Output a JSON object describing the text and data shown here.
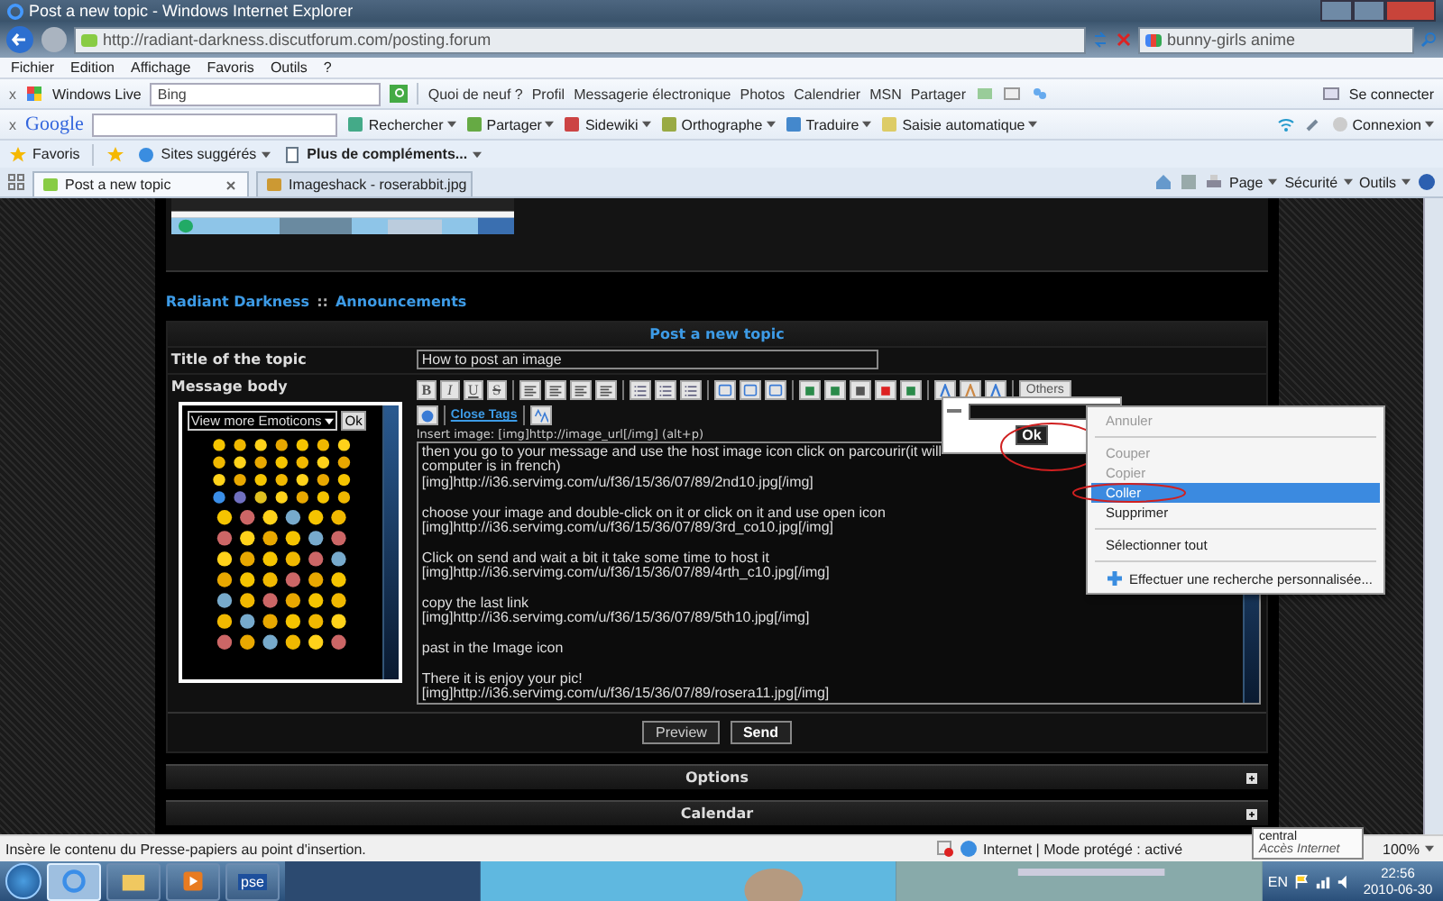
{
  "window": {
    "title": "Post a new topic - Windows Internet Explorer"
  },
  "address_bar": {
    "url": "http://radiant-darkness.discutforum.com/posting.forum",
    "search_value": "bunny-girls anime"
  },
  "menu_bar": [
    "Fichier",
    "Edition",
    "Affichage",
    "Favoris",
    "Outils",
    "?"
  ],
  "live_toolbar": {
    "close": "x",
    "brand": "Windows Live",
    "search_value": "Bing",
    "links": [
      "Quoi de neuf ?",
      "Profil",
      "Messagerie électronique",
      "Photos",
      "Calendrier",
      "MSN",
      "Partager"
    ],
    "sign_in": "Se connecter"
  },
  "google_toolbar": {
    "close": "x",
    "brand": "Google",
    "buttons": [
      "Rechercher",
      "Partager",
      "Sidewiki",
      "Orthographe",
      "Traduire",
      "Saisie automatique"
    ],
    "sign_in": "Connexion"
  },
  "favorites_bar": {
    "favorites": "Favoris",
    "items": [
      {
        "label": "Sites suggérés",
        "kind": "link"
      },
      {
        "label": "Plus de compléments...",
        "kind": "addon"
      }
    ]
  },
  "tabs": [
    {
      "label": "Post a new topic",
      "selected": true
    },
    {
      "label": "Imageshack - roserabbit.jpg",
      "selected": false
    }
  ],
  "command_bar": [
    "Page",
    "Sécurité",
    "Outils"
  ],
  "forum": {
    "breadcrumb": [
      "Radiant Darkness",
      "Announcements"
    ],
    "breadcrumb_separator": "::",
    "form_title": "Post a new topic",
    "title_label": "Title of the topic",
    "title_value": "How to post an image",
    "body_label": "Message body",
    "emoticon_select": "View more Emoticons",
    "emoticon_ok": "Ok",
    "format_buttons": [
      "B",
      "I",
      "U",
      "S"
    ],
    "others": "Others",
    "close_tags": "Close Tags",
    "hint": "Insert image: [img]http://image_url[/img] (alt+p)",
    "message": [
      [
        "then you go to your message and use the host image icon click on parcourir(it will",
        "computer is in french)",
        "[img]http://i36.servimg.com/u/f36/15/36/07/89/2nd10.jpg[/img]"
      ],
      [
        "choose your image and double-click on it or click on it and use open icon",
        "[img]http://i36.servimg.com/u/f36/15/36/07/89/3rd_co10.jpg[/img]"
      ],
      [
        "Click on send and wait a bit it take some time to host it",
        "[img]http://i36.servimg.com/u/f36/15/36/07/89/4rth_c10.jpg[/img]"
      ],
      [
        "copy the last link",
        "[img]http://i36.servimg.com/u/f36/15/36/07/89/5th10.jpg[/img]"
      ],
      [
        "past in the Image icon"
      ],
      [
        "There it is enjoy your pic!",
        "[img]http://i36.servimg.com/u/f36/15/36/07/89/rosera11.jpg[/img]"
      ]
    ],
    "buttons": [
      "Preview",
      "Send"
    ],
    "sections": [
      "Options",
      "Calendar"
    ]
  },
  "link_popup": {
    "button": "Ok"
  },
  "context_menu": [
    [
      {
        "label": "Annuler",
        "disabled": true,
        "selected": false
      }
    ],
    [
      {
        "label": "Couper",
        "disabled": true,
        "selected": false
      },
      {
        "label": "Copier",
        "disabled": true,
        "selected": false
      },
      {
        "label": "Coller",
        "disabled": false,
        "selected": true
      },
      {
        "label": "Supprimer",
        "disabled": false,
        "selected": false
      }
    ],
    [
      {
        "label": "Sélectionner tout",
        "disabled": false,
        "selected": false
      }
    ],
    [
      {
        "label": "Effectuer une recherche personnalisée...",
        "disabled": false,
        "selected": false
      }
    ]
  ],
  "status_bar": {
    "text": "Insère le contenu du Presse-papiers au point d'insertion.",
    "zone": "Internet | Mode protégé : activé",
    "zoom": "100%"
  },
  "tooltip": [
    "central",
    "Accès Internet"
  ],
  "taskbar": {
    "apps": [
      {
        "kind": "browser",
        "selected": true
      },
      {
        "kind": "folder",
        "selected": false
      },
      {
        "kind": "media",
        "selected": false
      },
      {
        "kind": "pse",
        "label": "pse",
        "selected": false
      }
    ],
    "language": "EN",
    "time": "22:56",
    "date": "2010-06-30"
  }
}
